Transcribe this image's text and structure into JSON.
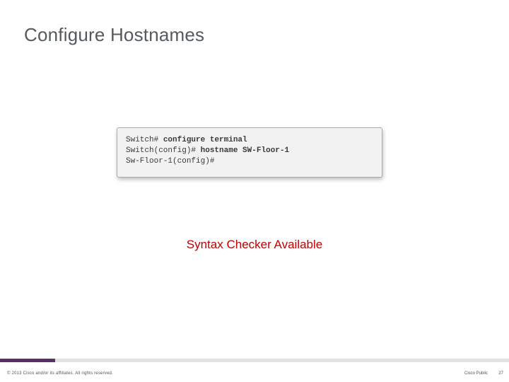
{
  "title": "Configure Hostnames",
  "terminal": {
    "line1_prompt": "Switch# ",
    "line1_cmd": "configure terminal",
    "line2_prompt": "Switch(config)# ",
    "line2_cmd": "hostname SW-Floor-1",
    "line3": "Sw-Floor-1(config)#"
  },
  "notice": "Syntax Checker Available",
  "footer": {
    "copyright": "© 2013 Cisco and/or its affiliates. All rights reserved.",
    "label": "Cisco Public",
    "page": "27"
  }
}
